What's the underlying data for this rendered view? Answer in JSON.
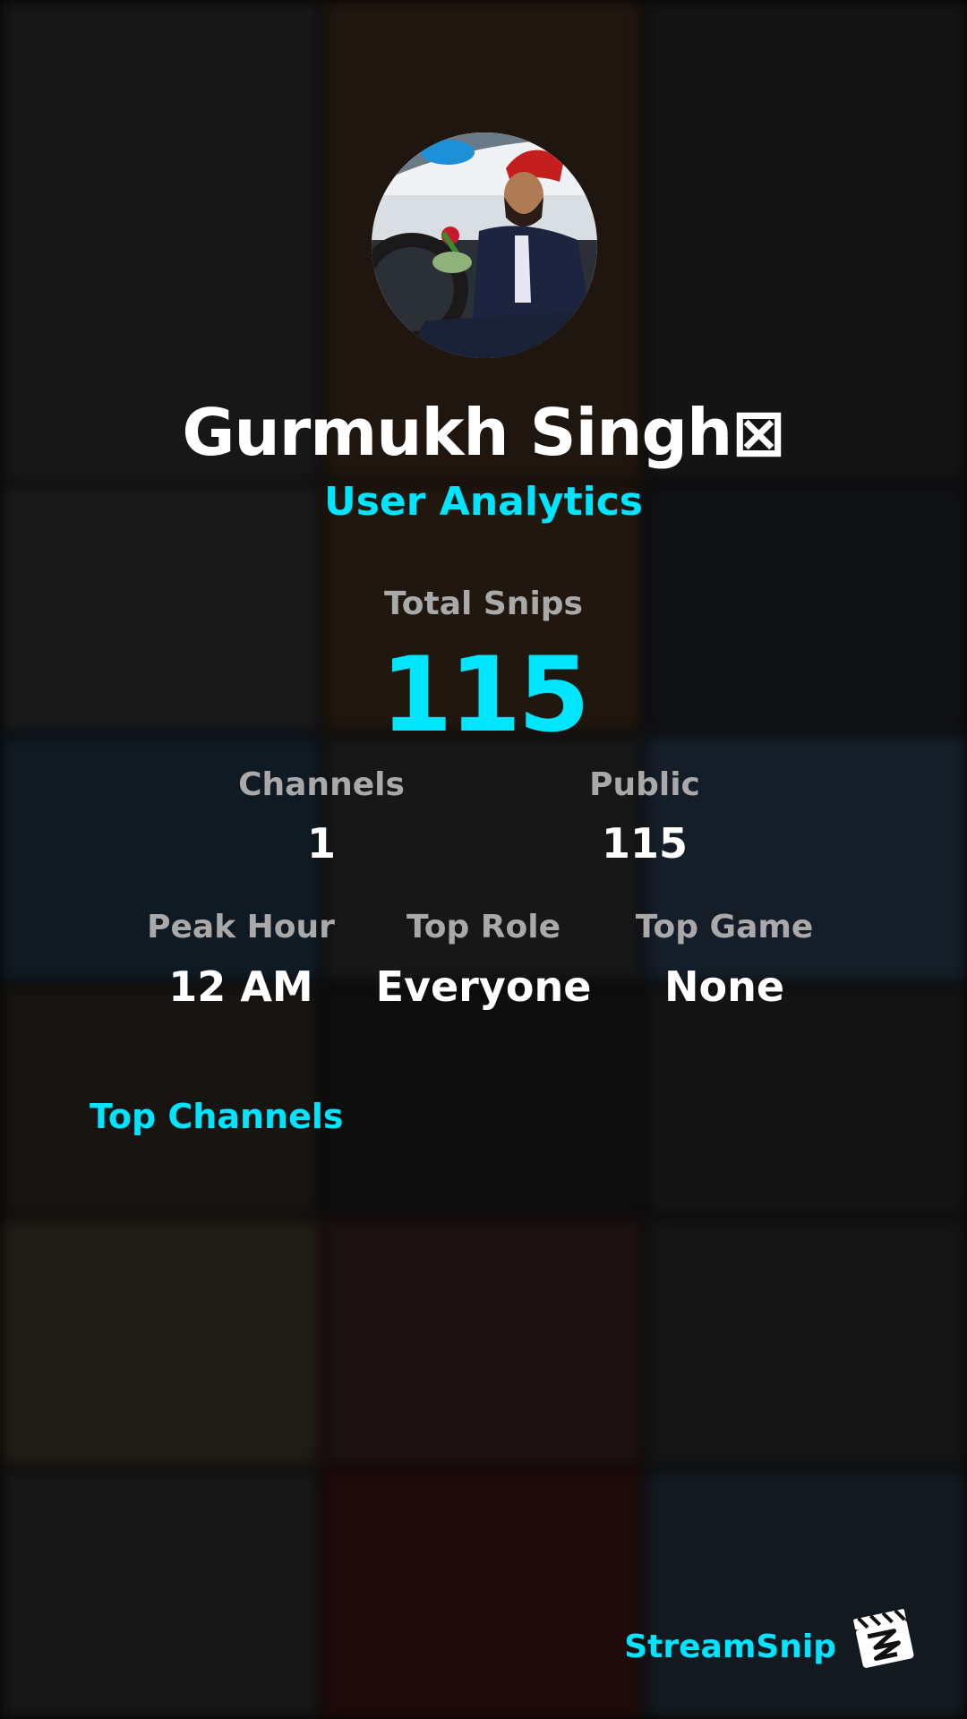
{
  "profile": {
    "name": "Gurmukh Singh⊠",
    "subtitle": "User Analytics"
  },
  "stats": {
    "total_snips_label": "Total Snips",
    "total_snips_value": "115",
    "channels_label": "Channels",
    "channels_value": "1",
    "public_label": "Public",
    "public_value": "115",
    "peak_hour_label": "Peak Hour",
    "peak_hour_value": "12 AM",
    "top_role_label": "Top Role",
    "top_role_value": "Everyone",
    "top_game_label": "Top Game",
    "top_game_value": "None"
  },
  "sections": {
    "top_channels": "Top Channels"
  },
  "branding": {
    "name": "StreamSnip",
    "logo_icon": "clapperboard-logo-icon"
  },
  "colors": {
    "accent": "#00e5ff",
    "text": "#ffffff",
    "muted": "#a9a9a9",
    "background": "#050505"
  }
}
